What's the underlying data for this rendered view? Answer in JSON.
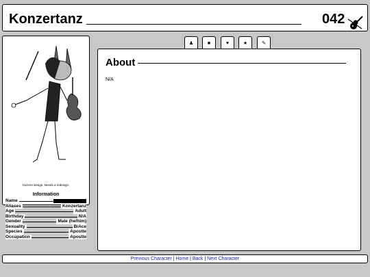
{
  "header": {
    "title": "Konzertanz",
    "number": "042",
    "logo_icon": "violin-icon"
  },
  "sidebar": {
    "portrait_icon": "character-portrait-violin",
    "caption": "Current design. Needs a redesign.",
    "info_heading": "Information",
    "info": [
      {
        "key": "Name",
        "value": "",
        "redacted": true
      },
      {
        "key": "Aliases",
        "value": "Konzertanz"
      },
      {
        "key": "Age",
        "value": "Adult"
      },
      {
        "key": "Birthday",
        "value": "N/A"
      },
      {
        "key": "Gender",
        "value": "Male (he/him)"
      },
      {
        "key": "Sexuality",
        "value": "BiAce"
      },
      {
        "key": "Species",
        "value": "Apostle"
      },
      {
        "key": "Occupation",
        "value": "Apostle"
      }
    ]
  },
  "tabs": [
    {
      "name": "tab-about",
      "icon": "user-icon",
      "glyph": "♟"
    },
    {
      "name": "tab-story",
      "icon": "book-icon",
      "glyph": "■"
    },
    {
      "name": "tab-relationships",
      "icon": "heart-icon",
      "glyph": "♥"
    },
    {
      "name": "tab-favorites",
      "icon": "star-icon",
      "glyph": "★"
    },
    {
      "name": "tab-art",
      "icon": "brush-icon",
      "glyph": "✎"
    }
  ],
  "main": {
    "heading": "About",
    "body": "N/A"
  },
  "footer": {
    "prev": "Previous Character",
    "home": "Home",
    "back": "Back",
    "next": "Next Character",
    "separator": "|"
  }
}
